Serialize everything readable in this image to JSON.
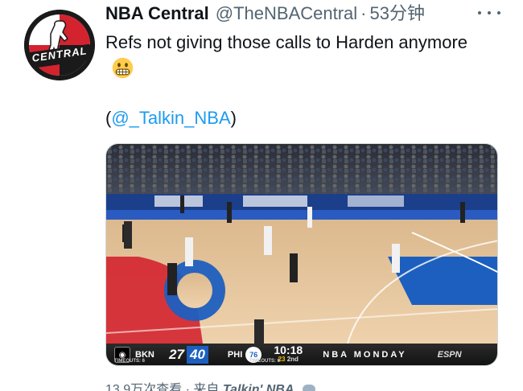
{
  "tweet": {
    "author_name": "NBA Central",
    "handle": "@TheNBACentral",
    "separator": "·",
    "time": "53分钟",
    "avatar_text": "CENTRAL",
    "text": "Refs not giving those calls to Harden anymore",
    "emoji": "grimacing-face",
    "mention_prefix": "(",
    "mention": "@_Talkin_NBA",
    "mention_suffix": ")"
  },
  "media": {
    "type": "video",
    "scoreboard": {
      "away_team": "BKN",
      "away_score": "27",
      "home_score": "40",
      "home_team": "PHI",
      "clock": "10:18",
      "period": "2nd",
      "shot_clock": "23",
      "show": "NBA MONDAY",
      "network": "ESPN",
      "away_timeouts": "TIMEOUTS: 6",
      "home_timeouts": "TIMEOUTS: 6"
    }
  },
  "footer": {
    "views": "13.9万次查看",
    "separator": "·",
    "from": "来自",
    "source": "Talkin' NBA"
  },
  "colors": {
    "text": "#0f1419",
    "secondary": "#536471",
    "link": "#1d9bf0",
    "court": "#e8c9a0",
    "paint_blue": "#1d5fbf",
    "paint_red": "#d3232f"
  }
}
